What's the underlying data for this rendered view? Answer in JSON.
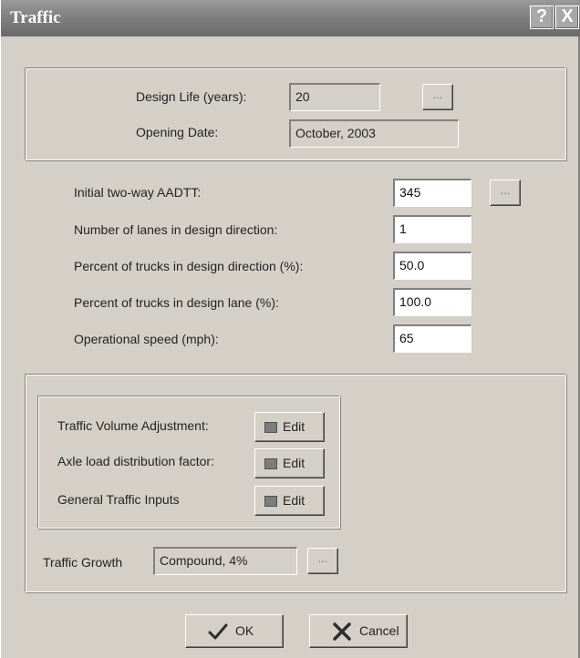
{
  "window": {
    "title": "Traffic",
    "help_glyph": "?",
    "close_glyph": "X"
  },
  "design": {
    "design_life_label": "Design Life (years):",
    "design_life_value": "20",
    "design_life_button": "...",
    "opening_date_label": "Opening Date:",
    "opening_date_value": "October, 2003"
  },
  "aadtt": {
    "initial_label": "Initial two-way AADTT:",
    "initial_value": "345",
    "initial_button": "...",
    "lanes_label": "Number of lanes in design direction:",
    "lanes_value": "1",
    "pct_direction_label": "Percent of trucks in design direction (%):",
    "pct_direction_value": "50.0",
    "pct_lane_label": "Percent of trucks in design lane (%):",
    "pct_lane_value": "100.0",
    "speed_label": "Operational speed (mph):",
    "speed_value": "65"
  },
  "adjustments": {
    "volume_label": "Traffic Volume Adjustment:",
    "axle_label": "Axle load distribution factor:",
    "general_label": "General Traffic Inputs",
    "edit_label": "Edit"
  },
  "growth": {
    "label": "Traffic Growth",
    "value": "Compound, 4%",
    "button": "..."
  },
  "footer": {
    "ok_label": "OK",
    "cancel_label": "Cancel"
  },
  "icons": {
    "ok": "checkmark-icon",
    "cancel": "x-cross-icon",
    "edit": "color-swatch-icon"
  }
}
